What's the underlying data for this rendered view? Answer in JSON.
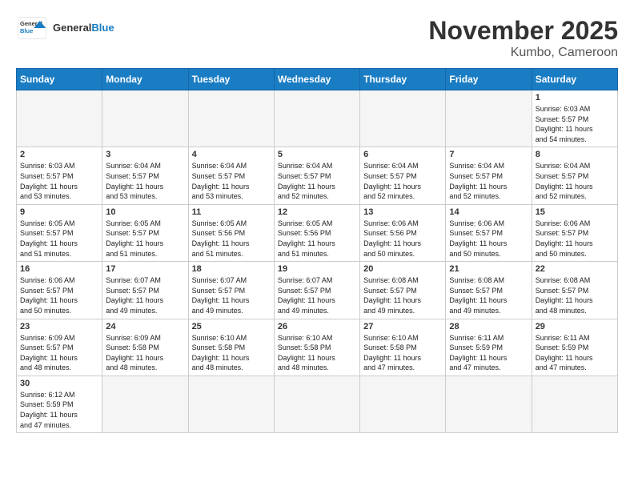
{
  "logo": {
    "general": "General",
    "blue": "Blue"
  },
  "title": "November 2025",
  "location": "Kumbo, Cameroon",
  "days_of_week": [
    "Sunday",
    "Monday",
    "Tuesday",
    "Wednesday",
    "Thursday",
    "Friday",
    "Saturday"
  ],
  "weeks": [
    [
      {
        "day": "",
        "info": ""
      },
      {
        "day": "",
        "info": ""
      },
      {
        "day": "",
        "info": ""
      },
      {
        "day": "",
        "info": ""
      },
      {
        "day": "",
        "info": ""
      },
      {
        "day": "",
        "info": ""
      },
      {
        "day": "1",
        "info": "Sunrise: 6:03 AM\nSunset: 5:57 PM\nDaylight: 11 hours\nand 54 minutes."
      }
    ],
    [
      {
        "day": "2",
        "info": "Sunrise: 6:03 AM\nSunset: 5:57 PM\nDaylight: 11 hours\nand 53 minutes."
      },
      {
        "day": "3",
        "info": "Sunrise: 6:04 AM\nSunset: 5:57 PM\nDaylight: 11 hours\nand 53 minutes."
      },
      {
        "day": "4",
        "info": "Sunrise: 6:04 AM\nSunset: 5:57 PM\nDaylight: 11 hours\nand 53 minutes."
      },
      {
        "day": "5",
        "info": "Sunrise: 6:04 AM\nSunset: 5:57 PM\nDaylight: 11 hours\nand 52 minutes."
      },
      {
        "day": "6",
        "info": "Sunrise: 6:04 AM\nSunset: 5:57 PM\nDaylight: 11 hours\nand 52 minutes."
      },
      {
        "day": "7",
        "info": "Sunrise: 6:04 AM\nSunset: 5:57 PM\nDaylight: 11 hours\nand 52 minutes."
      },
      {
        "day": "8",
        "info": "Sunrise: 6:04 AM\nSunset: 5:57 PM\nDaylight: 11 hours\nand 52 minutes."
      }
    ],
    [
      {
        "day": "9",
        "info": "Sunrise: 6:05 AM\nSunset: 5:57 PM\nDaylight: 11 hours\nand 51 minutes."
      },
      {
        "day": "10",
        "info": "Sunrise: 6:05 AM\nSunset: 5:57 PM\nDaylight: 11 hours\nand 51 minutes."
      },
      {
        "day": "11",
        "info": "Sunrise: 6:05 AM\nSunset: 5:56 PM\nDaylight: 11 hours\nand 51 minutes."
      },
      {
        "day": "12",
        "info": "Sunrise: 6:05 AM\nSunset: 5:56 PM\nDaylight: 11 hours\nand 51 minutes."
      },
      {
        "day": "13",
        "info": "Sunrise: 6:06 AM\nSunset: 5:56 PM\nDaylight: 11 hours\nand 50 minutes."
      },
      {
        "day": "14",
        "info": "Sunrise: 6:06 AM\nSunset: 5:57 PM\nDaylight: 11 hours\nand 50 minutes."
      },
      {
        "day": "15",
        "info": "Sunrise: 6:06 AM\nSunset: 5:57 PM\nDaylight: 11 hours\nand 50 minutes."
      }
    ],
    [
      {
        "day": "16",
        "info": "Sunrise: 6:06 AM\nSunset: 5:57 PM\nDaylight: 11 hours\nand 50 minutes."
      },
      {
        "day": "17",
        "info": "Sunrise: 6:07 AM\nSunset: 5:57 PM\nDaylight: 11 hours\nand 49 minutes."
      },
      {
        "day": "18",
        "info": "Sunrise: 6:07 AM\nSunset: 5:57 PM\nDaylight: 11 hours\nand 49 minutes."
      },
      {
        "day": "19",
        "info": "Sunrise: 6:07 AM\nSunset: 5:57 PM\nDaylight: 11 hours\nand 49 minutes."
      },
      {
        "day": "20",
        "info": "Sunrise: 6:08 AM\nSunset: 5:57 PM\nDaylight: 11 hours\nand 49 minutes."
      },
      {
        "day": "21",
        "info": "Sunrise: 6:08 AM\nSunset: 5:57 PM\nDaylight: 11 hours\nand 49 minutes."
      },
      {
        "day": "22",
        "info": "Sunrise: 6:08 AM\nSunset: 5:57 PM\nDaylight: 11 hours\nand 48 minutes."
      }
    ],
    [
      {
        "day": "23",
        "info": "Sunrise: 6:09 AM\nSunset: 5:57 PM\nDaylight: 11 hours\nand 48 minutes."
      },
      {
        "day": "24",
        "info": "Sunrise: 6:09 AM\nSunset: 5:58 PM\nDaylight: 11 hours\nand 48 minutes."
      },
      {
        "day": "25",
        "info": "Sunrise: 6:10 AM\nSunset: 5:58 PM\nDaylight: 11 hours\nand 48 minutes."
      },
      {
        "day": "26",
        "info": "Sunrise: 6:10 AM\nSunset: 5:58 PM\nDaylight: 11 hours\nand 48 minutes."
      },
      {
        "day": "27",
        "info": "Sunrise: 6:10 AM\nSunset: 5:58 PM\nDaylight: 11 hours\nand 47 minutes."
      },
      {
        "day": "28",
        "info": "Sunrise: 6:11 AM\nSunset: 5:59 PM\nDaylight: 11 hours\nand 47 minutes."
      },
      {
        "day": "29",
        "info": "Sunrise: 6:11 AM\nSunset: 5:59 PM\nDaylight: 11 hours\nand 47 minutes."
      }
    ],
    [
      {
        "day": "30",
        "info": "Sunrise: 6:12 AM\nSunset: 5:59 PM\nDaylight: 11 hours\nand 47 minutes."
      },
      {
        "day": "",
        "info": ""
      },
      {
        "day": "",
        "info": ""
      },
      {
        "day": "",
        "info": ""
      },
      {
        "day": "",
        "info": ""
      },
      {
        "day": "",
        "info": ""
      },
      {
        "day": "",
        "info": ""
      }
    ]
  ]
}
